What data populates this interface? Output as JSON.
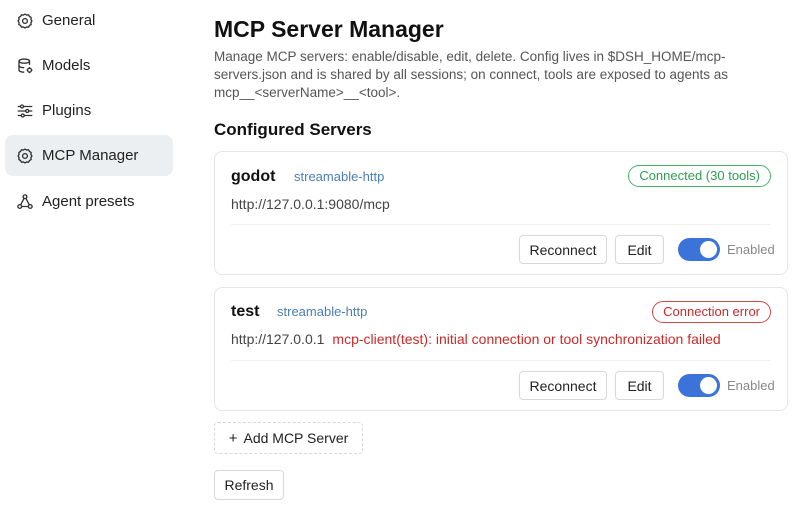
{
  "sidebar": {
    "items": [
      {
        "label": "General",
        "icon": "gear-icon",
        "active": false
      },
      {
        "label": "Models",
        "icon": "database-icon",
        "active": false
      },
      {
        "label": "Plugins",
        "icon": "sliders-icon",
        "active": false
      },
      {
        "label": "MCP Manager",
        "icon": "gear-icon",
        "active": true
      },
      {
        "label": "Agent presets",
        "icon": "nodes-icon",
        "active": false
      }
    ]
  },
  "main": {
    "title": "MCP Server Manager",
    "description": "Manage MCP servers: enable/disable, edit, delete. Config lives in $DSH_HOME/mcp-servers.json and is shared by all sessions; on connect, tools are exposed to agents as mcp__<serverName>__<tool>.",
    "section_title": "Configured Servers",
    "servers": [
      {
        "name": "godot",
        "transport": "streamable-http",
        "status": "Connected (30 tools)",
        "status_kind": "ok",
        "url": "http://127.0.0.1:9080/mcp",
        "error": "",
        "reconnect_label": "Reconnect",
        "edit_label": "Edit",
        "enabled": true,
        "enabled_label": "Enabled"
      },
      {
        "name": "test",
        "transport": "streamable-http",
        "status": "Connection error",
        "status_kind": "err",
        "url": "http://127.0.0.1",
        "error": "mcp-client(test): initial connection or tool synchronization failed",
        "reconnect_label": "Reconnect",
        "edit_label": "Edit",
        "enabled": true,
        "enabled_label": "Enabled"
      }
    ],
    "add_label": "Add MCP Server",
    "add_icon": "plus-icon",
    "refresh_label": "Refresh"
  },
  "colors": {
    "accent": "#3b73d9",
    "ok": "#2e9e52",
    "error": "#c92a2a",
    "link": "#4a7fb5"
  }
}
